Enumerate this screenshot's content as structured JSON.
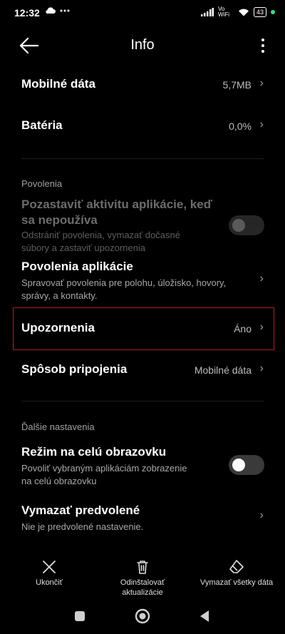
{
  "status_bar": {
    "time": "12:32",
    "network_label": "Vo WiFi",
    "battery": "43"
  },
  "header": {
    "title": "Info"
  },
  "rows": {
    "mobile_data": {
      "label": "Mobilné dáta",
      "value": "5,7MB"
    },
    "battery": {
      "label": "Batéria",
      "value": "0,0%"
    }
  },
  "permissions": {
    "section_label": "Povolenia",
    "pause_activity": {
      "title_line1": "Pozastaviť aktivitu aplikácie, keď",
      "title_line2": "sa nepoužíva",
      "desc_line1": "Odstrániť povolenia, vymazať dočasné",
      "desc_line2": "súbory a zastaviť upozornenia",
      "enabled": false
    },
    "app_permissions": {
      "title": "Povolenia aplikácie",
      "desc_line1": "Spravovať povolenia pre polohu, úložisko, hovory,",
      "desc_line2": "správy, a kontakty."
    },
    "notifications": {
      "label": "Upozornenia",
      "value": "Áno"
    },
    "connection": {
      "label": "Spôsob pripojenia",
      "value": "Mobilné dáta"
    }
  },
  "more_settings": {
    "section_label": "Ďalšie nastavenia",
    "fullscreen": {
      "title": "Režim na celú obrazovku",
      "desc_line1": "Povoliť vybraným aplikáciám zobrazenie",
      "desc_line2": "na celú obrazovku",
      "enabled": false
    },
    "clear_defaults": {
      "title": "Vymazať predvolené",
      "desc": "Nie je predvolené nastavenie."
    }
  },
  "bottom_actions": {
    "stop": "Ukončiť",
    "uninstall_line1": "Odinštalovať",
    "uninstall_line2": "aktualizácie",
    "clear_data": "Vymazať všetky dáta"
  },
  "colors": {
    "background": "#000000",
    "highlight_border": "#b71c1c",
    "toggle_off": "#3a3a3a"
  }
}
